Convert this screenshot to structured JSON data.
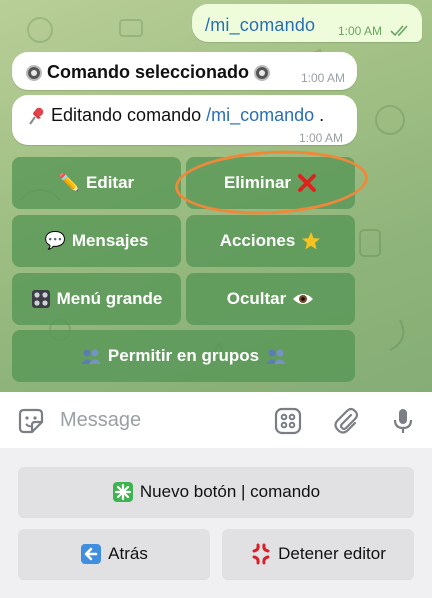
{
  "chat": {
    "outgoing": {
      "text": "/mi_comando",
      "time": "1:00 AM"
    },
    "messages": [
      {
        "prefix_icon": "radio-button",
        "text": "Comando seleccionado",
        "suffix_icon": "radio-button",
        "time": "1:00 AM"
      },
      {
        "prefix_icon": "pushpin",
        "text": "Editando comando ",
        "link": "/mi_comando",
        "suffix": ".",
        "time": "1:00 AM"
      }
    ]
  },
  "inline_keyboard": [
    {
      "label": "Editar",
      "icon": "✏️"
    },
    {
      "label": "Eliminar",
      "icon": "❌"
    },
    {
      "label": "Mensajes",
      "icon": "💬"
    },
    {
      "label": "Acciones",
      "icon": "🌟"
    },
    {
      "label": "Menú grande",
      "icon": "🎛️"
    },
    {
      "label": "Ocultar",
      "icon": "👁️"
    },
    {
      "label": "Permitir en grupos",
      "icon": "👥"
    }
  ],
  "input": {
    "placeholder": "Message"
  },
  "reply_keyboard": [
    {
      "label": "Nuevo botón | comando",
      "icon": "✳️"
    },
    {
      "label": "Atrás",
      "icon": "⬅️"
    },
    {
      "label": "Detener editor",
      "icon": "💢"
    }
  ],
  "colors": {
    "accent_link": "#2a6fb5",
    "annotation_circle": "#f0883a",
    "button_green": "#5f9a5f"
  }
}
